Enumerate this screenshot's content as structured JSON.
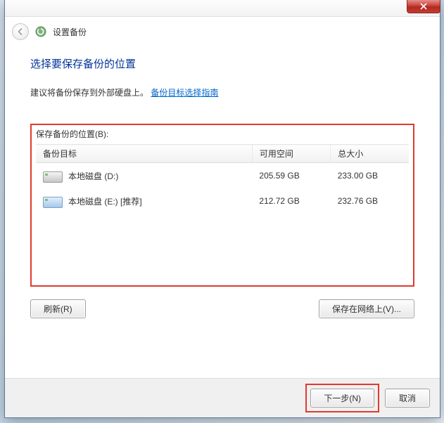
{
  "header": {
    "title": "设置备份"
  },
  "main": {
    "heading": "选择要保存备份的位置",
    "hint_text": "建议将备份保存到外部硬盘上。",
    "hint_link": "备份目标选择指南",
    "save_label": "保存备份的位置(B):",
    "columns": {
      "target": "备份目标",
      "free": "可用空间",
      "total": "总大小"
    },
    "drives": [
      {
        "name": "本地磁盘 (D:)",
        "free": "205.59 GB",
        "total": "233.00 GB"
      },
      {
        "name": "本地磁盘 (E:) [推荐]",
        "free": "212.72 GB",
        "total": "232.76 GB"
      }
    ]
  },
  "buttons": {
    "refresh": "刷新(R)",
    "save_network": "保存在网络上(V)...",
    "next": "下一步(N)",
    "cancel": "取消"
  }
}
